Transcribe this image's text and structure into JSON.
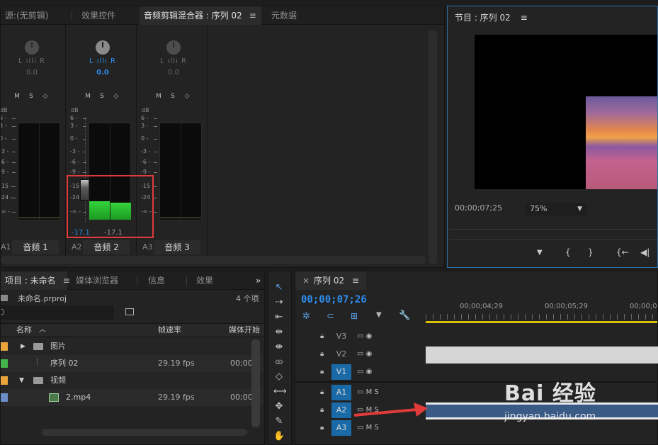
{
  "source_panel": {
    "tabs": [
      {
        "label": "源:(无剪辑)"
      },
      {
        "label": "效果控件"
      },
      {
        "label": "音频剪辑混合器 : 序列 02"
      },
      {
        "label": "元数据"
      }
    ],
    "tab_menu_icon": "≡"
  },
  "mixer": {
    "channels": [
      {
        "id": "A1",
        "name": "音频 1",
        "lr": "L ıllı R",
        "pan": "0.0",
        "m": "M",
        "s": "S",
        "r": "◇",
        "db_label": "dB"
      },
      {
        "id": "A2",
        "name": "音频 2",
        "lr": "L ıllı R",
        "pan": "0.0",
        "m": "M",
        "s": "S",
        "r": "◇",
        "db_label": "dB",
        "fader_value": "-17.1",
        "meter_value": "-17.1",
        "level_left": 0.19,
        "level_right": 0.18
      },
      {
        "id": "A3",
        "name": "音频 3",
        "lr": "L ıllı R",
        "pan": "0.0",
        "m": "M",
        "s": "S",
        "r": "◇",
        "db_label": "dB"
      }
    ],
    "scale_ticks": [
      "6 -",
      "3 -",
      "0 -",
      "-3 -",
      "-6 -",
      "-9 -",
      "-15 -",
      "-24 -",
      "-∞ -"
    ]
  },
  "program_monitor": {
    "title": "节目 : 序列 02",
    "timecode": "00;00;07;25",
    "zoom": "75%",
    "controls": [
      "▼",
      "{",
      "}",
      "{←",
      "◀|"
    ]
  },
  "project_panel": {
    "tabs": [
      {
        "label": "项目 : 未命名"
      },
      {
        "label": "媒体浏览器"
      },
      {
        "label": "信息"
      },
      {
        "label": "效果"
      }
    ],
    "project_file": "未命名.prproj",
    "item_count": "4 个项",
    "search_placeholder": "",
    "columns": {
      "name": "名称",
      "fps": "帧速率",
      "media_start": "媒体开始"
    },
    "rows": [
      {
        "name": "图片",
        "fps": "",
        "start": "",
        "color": "#e8a33d"
      },
      {
        "name": "序列 02",
        "fps": "29.19 fps",
        "start": "00;00",
        "color": "#43b54a"
      },
      {
        "name": "视频",
        "fps": "",
        "start": "",
        "color": "#e8a33d"
      },
      {
        "name": "2.mp4",
        "fps": "29.19 fps",
        "start": "00;00",
        "color": "#6e8fc6"
      }
    ]
  },
  "timeline": {
    "tab_label": "序列 02",
    "close": "×",
    "timecode": "00;00;07;26",
    "ruler": [
      "00;00;04;29",
      "00;00;05;29",
      "00;00;0"
    ],
    "tracks": [
      {
        "id": "V3",
        "kind": "video"
      },
      {
        "id": "V2",
        "kind": "video"
      },
      {
        "id": "V1",
        "kind": "video"
      },
      {
        "id": "A1",
        "kind": "audio"
      },
      {
        "id": "A2",
        "kind": "audio"
      },
      {
        "id": "A3",
        "kind": "audio"
      }
    ],
    "track_video_icons": "▭ ◉",
    "track_audio_icons": "▭ M  S"
  },
  "watermark": {
    "brand": "Bai 经验",
    "url": "jingyan.baidu.com"
  },
  "colors": {
    "accent_blue": "#2d8ceb",
    "meter_green": "#2ec23a",
    "highlight_red": "#e03a3a",
    "clip_blue": "#3a5a86"
  }
}
